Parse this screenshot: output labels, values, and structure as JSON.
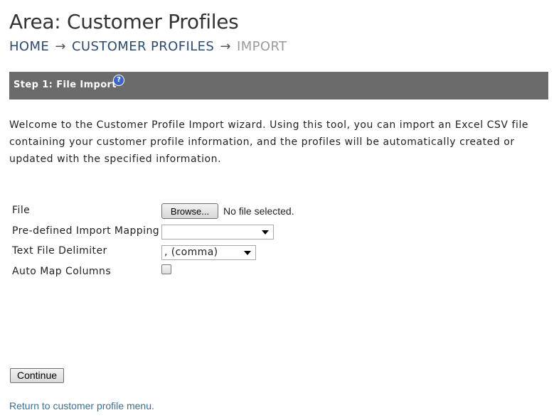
{
  "header": {
    "title": "Area: Customer Profiles"
  },
  "breadcrumb": {
    "home": "HOME",
    "customer_profiles": "CUSTOMER PROFILES",
    "current": "IMPORT",
    "separator": "→"
  },
  "step": {
    "label": "Step 1: File Import",
    "help_icon": "question-mark-icon",
    "help_glyph": "?"
  },
  "intro": {
    "text": "Welcome to the Customer Profile Import wizard. Using this tool, you can import an Excel CSV file containing your customer profile information, and the profiles will be automatically created or updated with the specified information."
  },
  "form": {
    "file": {
      "label": "File",
      "browse_label": "Browse...",
      "status": "No file selected."
    },
    "mapping": {
      "label": "Pre-defined Import Mapping",
      "selected": ""
    },
    "delimiter": {
      "label": "Text File Delimiter",
      "selected": ", (comma)"
    },
    "auto_map": {
      "label": "Auto Map Columns",
      "checked": false
    }
  },
  "actions": {
    "continue_label": "Continue"
  },
  "footer": {
    "return_link": "Return to customer profile menu."
  },
  "colors": {
    "step_bar": "#6b6b6b",
    "link": "#2e4a6b",
    "breadcrumb_current": "#9a9a9a",
    "return_link": "#3b6f8f",
    "help_icon": "#3d64c7"
  }
}
